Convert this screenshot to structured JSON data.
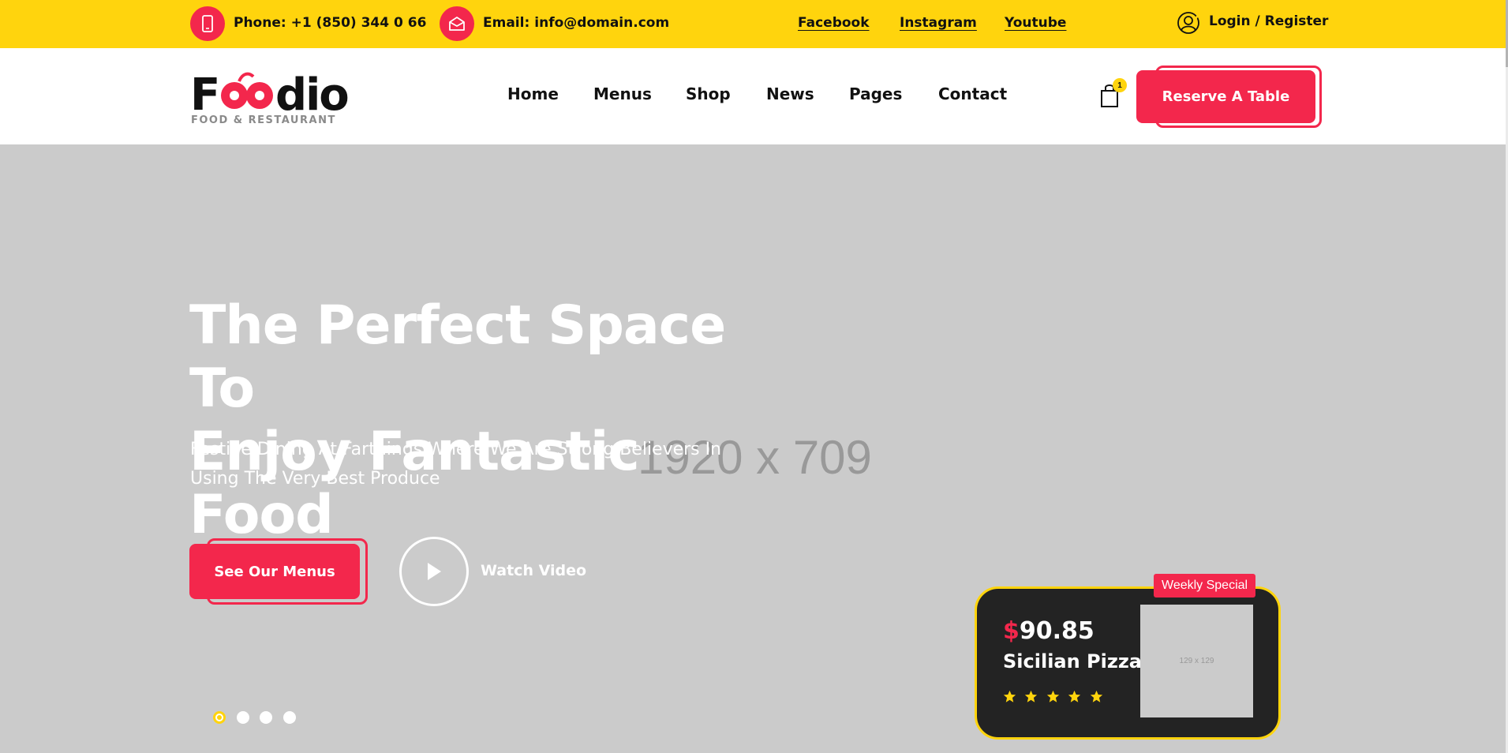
{
  "topbar": {
    "phone_label": "Phone:",
    "phone_value": "+1 (850) 344 0 66",
    "email_label": "Email:",
    "email_value": "info@domain.com",
    "social": [
      "Facebook",
      "Instagram",
      "Youtube"
    ],
    "login": "Login / Register"
  },
  "header": {
    "logo_word": "Foodio",
    "logo_tagline": "FOOD & RESTAURANT",
    "nav": [
      "Home",
      "Menus",
      "Shop",
      "News",
      "Pages",
      "Contact"
    ],
    "cart_count": "1",
    "reserve_label": "Reserve A Table"
  },
  "hero": {
    "placeholder": "1920 x 709",
    "title_line1": "The Perfect Space To",
    "title_line2": "Enjoy Fantastic Food",
    "subtitle_line1": "Festive Dining At Farthings Where We Are Strong Believers In",
    "subtitle_line2": "Using The Very Best Produce",
    "menus_button": "See Our Menus",
    "watch_video": "Watch Video",
    "slides_total": 4,
    "slide_active": 1
  },
  "special": {
    "badge": "Weekly Special",
    "currency": "$",
    "price": "90.85",
    "name": "Sicilian Pizza",
    "rating": 5,
    "image_placeholder": "129 x 129"
  },
  "colors": {
    "accent_yellow": "#ffd40d",
    "accent_red": "#f3274c",
    "hero_bg": "#cbcbcb",
    "card_bg": "#232323"
  },
  "icons": {
    "phone": "phone-icon",
    "email": "email-icon",
    "user": "user-icon",
    "cart": "cart-icon",
    "play": "play-icon",
    "star": "star-icon"
  }
}
